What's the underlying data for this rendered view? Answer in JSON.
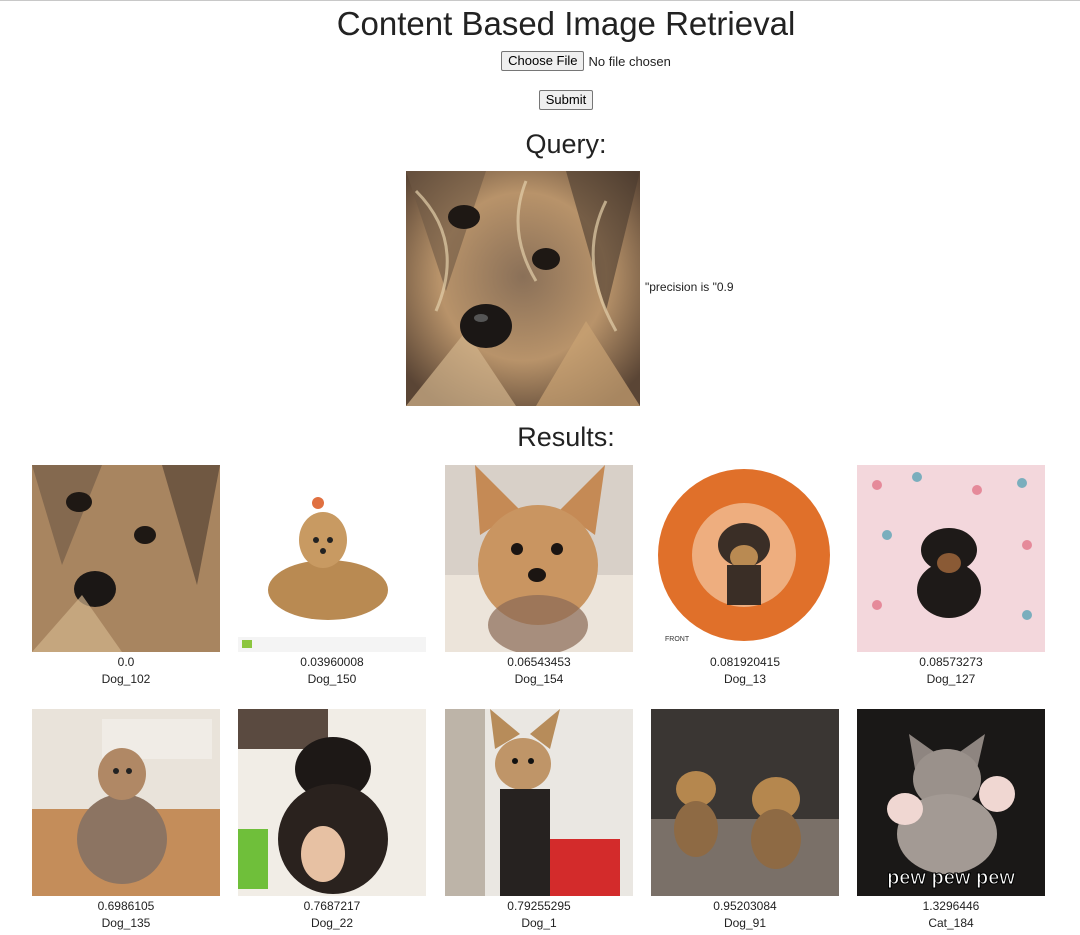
{
  "page": {
    "title": "Content Based Image Retrieval",
    "choose_file_label": "Choose File",
    "file_status": "No file chosen",
    "submit_label": "Submit",
    "query_heading": "Query:",
    "precision_text": "\"precision is \"0.9",
    "results_heading": "Results:"
  },
  "results": [
    {
      "score": "0.0",
      "label": "Dog_102"
    },
    {
      "score": "0.03960008",
      "label": "Dog_150"
    },
    {
      "score": "0.06543453",
      "label": "Dog_154"
    },
    {
      "score": "0.081920415",
      "label": "Dog_13"
    },
    {
      "score": "0.08573273",
      "label": "Dog_127"
    },
    {
      "score": "0.6986105",
      "label": "Dog_135"
    },
    {
      "score": "0.7687217",
      "label": "Dog_22"
    },
    {
      "score": "0.79255295",
      "label": "Dog_1"
    },
    {
      "score": "0.95203084",
      "label": "Dog_91"
    },
    {
      "score": "1.3296446",
      "label": "Cat_184"
    }
  ],
  "thumb_texts": {
    "front_stamp": "FRONT",
    "pew_caption": "pew pew pew"
  },
  "colors": {
    "fur_tan": "#b98a52",
    "fur_dark": "#3a2e26",
    "orange_disc": "#e0702a",
    "pink_blanket": "#f3d7dc"
  }
}
